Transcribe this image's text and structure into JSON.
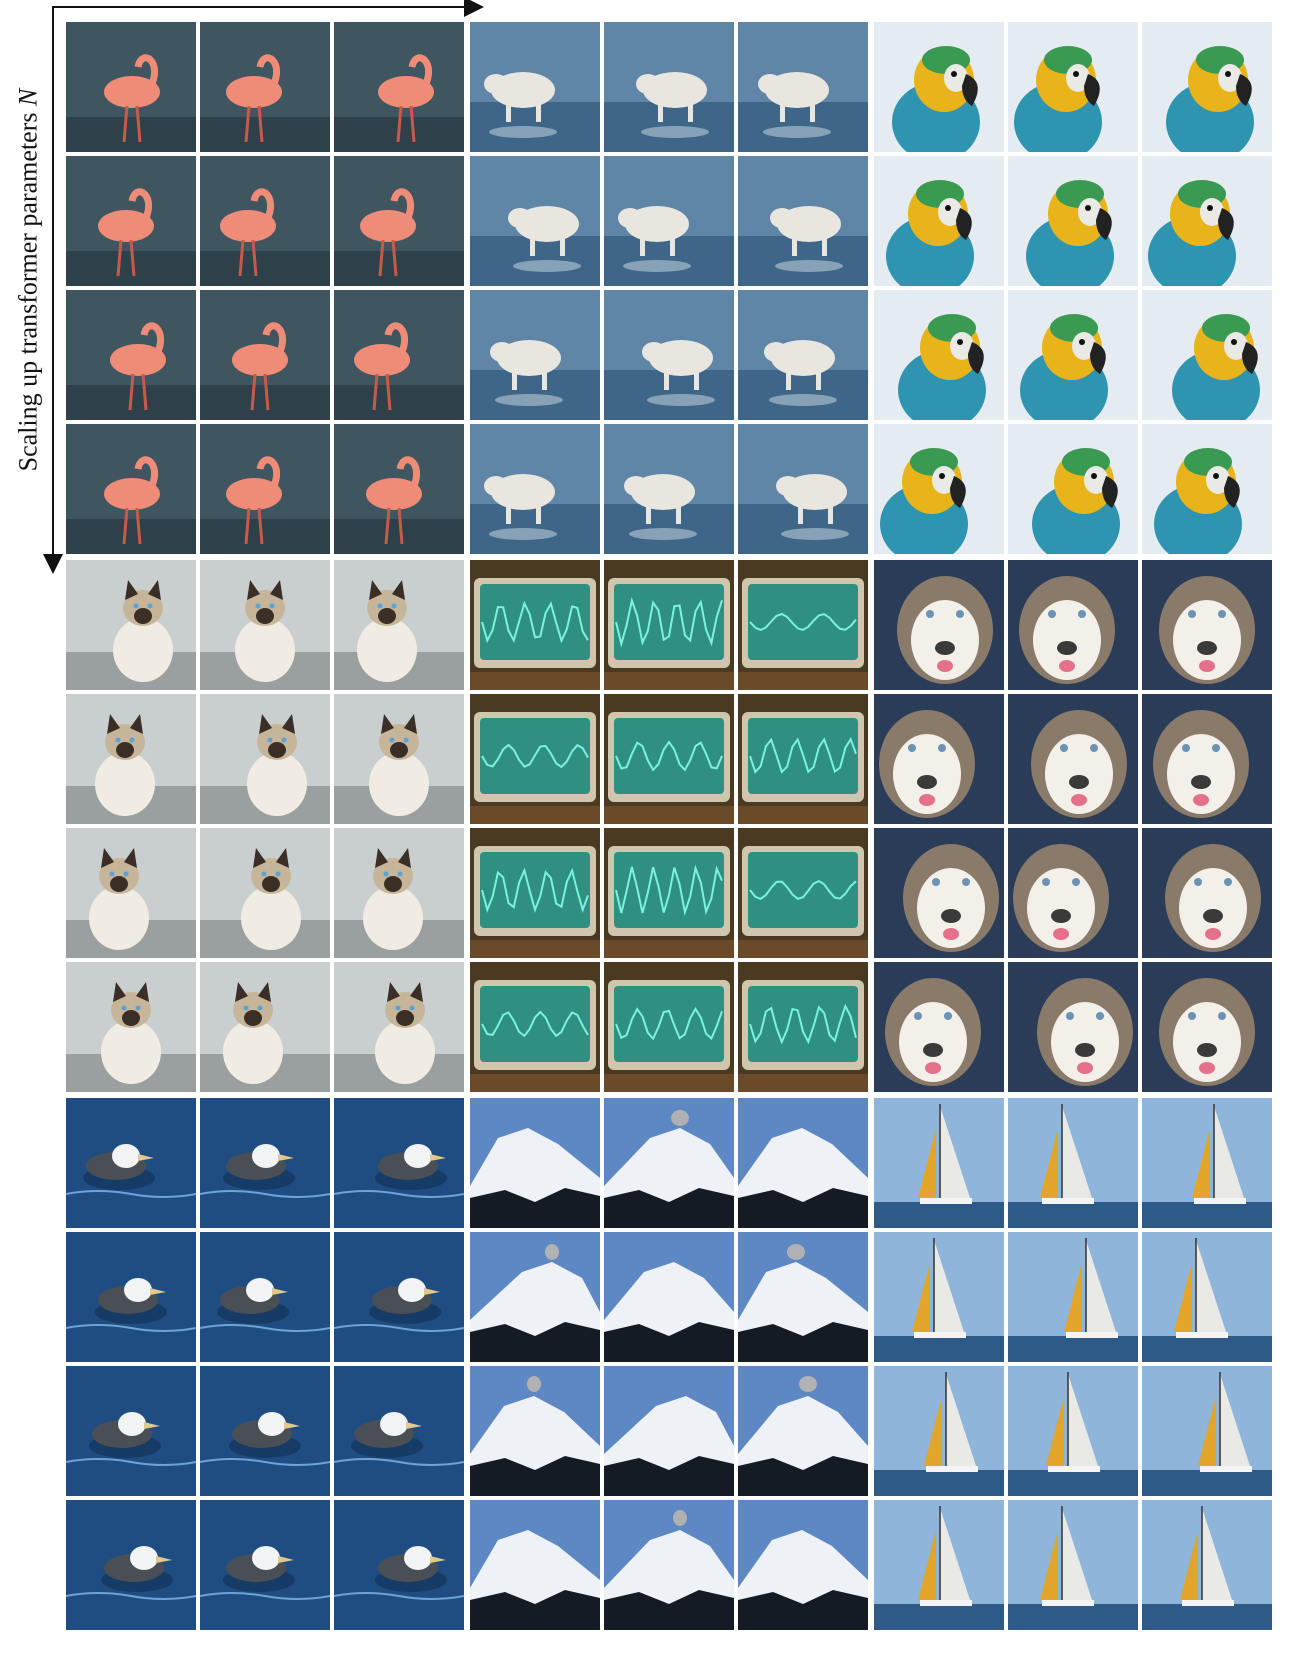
{
  "axis": {
    "label_text": "Scaling up transformer parameters ",
    "label_var": "N"
  },
  "grid": {
    "rows_per_block": 4,
    "cols_per_block": 3,
    "blocks": [
      {
        "subject": "flamingo",
        "colors": {
          "bg": "#3f5560",
          "fg": "#ee8c78",
          "accent": "#c85a4a"
        }
      },
      {
        "subject": "arctic-wolf",
        "colors": {
          "bg": "#5f86a6",
          "fg": "#e8e6df",
          "accent": "#cfdbe6"
        }
      },
      {
        "subject": "macaw",
        "colors": {
          "bg": "#e4ecf2",
          "fg": "#2f94b0",
          "accent": "#e8b41a"
        }
      },
      {
        "subject": "siamese-cat",
        "colors": {
          "bg": "#c9cfcf",
          "fg": "#f1ece3",
          "accent": "#3a2e26"
        }
      },
      {
        "subject": "oscilloscope",
        "colors": {
          "bg": "#4a3a22",
          "fg": "#2f8f80",
          "accent": "#7af2e0"
        }
      },
      {
        "subject": "husky",
        "colors": {
          "bg": "#2a3c57",
          "fg": "#f3efe9",
          "accent": "#3a3a3a"
        }
      },
      {
        "subject": "albatross",
        "colors": {
          "bg": "#1f4d82",
          "fg": "#f1f3f4",
          "accent": "#4a4f55"
        }
      },
      {
        "subject": "volcano",
        "colors": {
          "bg": "#5d88c4",
          "fg": "#eef2f6",
          "accent": "#141b24"
        }
      },
      {
        "subject": "sailboat",
        "colors": {
          "bg": "#8fb6da",
          "fg": "#e9e9e6",
          "accent": "#e0a52a"
        }
      }
    ]
  }
}
